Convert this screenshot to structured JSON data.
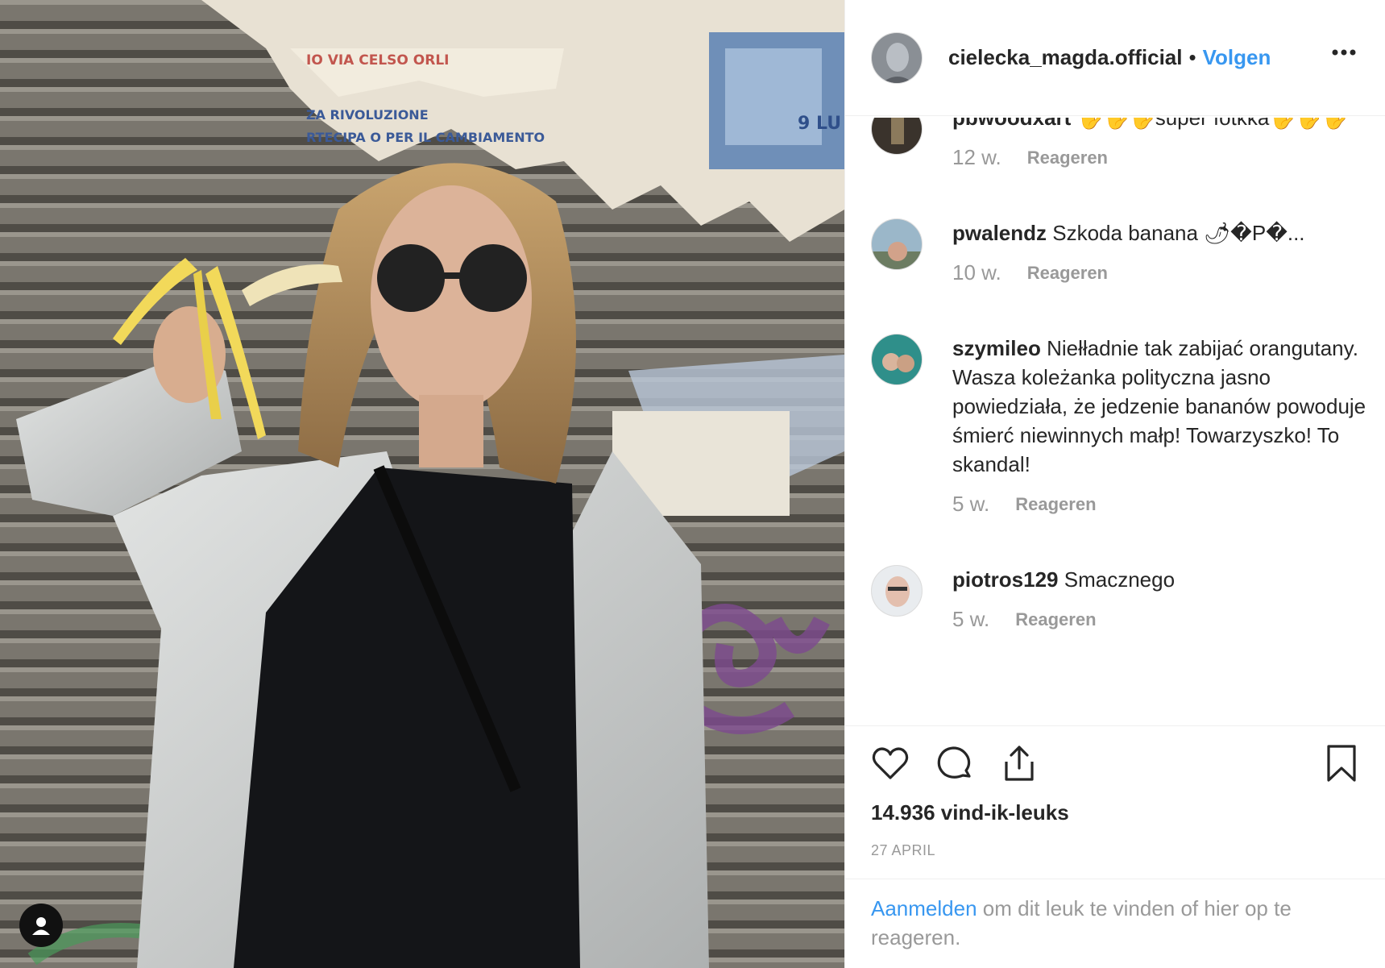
{
  "post": {
    "author": "cielecka_magda.official",
    "separator": "•",
    "follow_label": "Volgen",
    "more_icon": "more-options-icon"
  },
  "comments": [
    {
      "user": "pbwoodxart",
      "text": "🖐🖐🖐super fotkka🖐🖐🖐",
      "age": "12 w.",
      "reply": "Reageren"
    },
    {
      "user": "pwalendz",
      "text": "Szkoda banana 🌶�P�...",
      "age": "10 w.",
      "reply": "Reageren"
    },
    {
      "user": "szymileo",
      "text": "Niełładnie tak zabijać orangutany. Wasza koleżanka polityczna jasno powiedziała, że jedzenie bananów powoduje śmierć niewinnych małp! Towarzyszko! To skandal!",
      "age": "5 w.",
      "reply": "Reageren"
    },
    {
      "user": "piotros129",
      "text": "Smacznego",
      "age": "5 w.",
      "reply": "Reageren"
    }
  ],
  "actions": {
    "like_icon": "heart-icon",
    "comment_icon": "comment-icon",
    "share_icon": "share-icon",
    "save_icon": "bookmark-icon"
  },
  "likes": "14.936 vind-ik-leuks",
  "date": "27 APRIL",
  "login": {
    "link": "Aanmelden",
    "text": " om dit leuk te vinden of hier op te reageren."
  },
  "photo": {
    "tag_icon": "user-tag-icon"
  }
}
